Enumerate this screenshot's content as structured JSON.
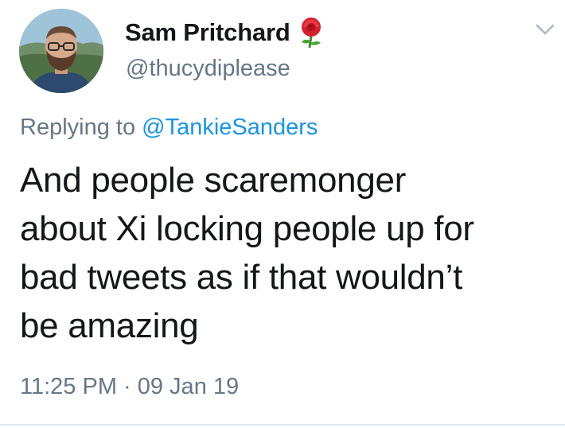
{
  "author": {
    "display_name": "Sam Pritchard",
    "name_emoji": "rose-icon",
    "handle": "@thucydiplease",
    "avatar": "avatar-photo"
  },
  "reply": {
    "prefix": "Replying to ",
    "mention": "@TankieSanders"
  },
  "tweet": {
    "text": "And people scaremonger\nabout Xi locking people up for\nbad tweets as if that wouldn’t\nbe amazing",
    "timestamp": "11:25 PM · 09 Jan 19"
  },
  "menu": {
    "icon": "chevron-down-icon"
  },
  "colors": {
    "text_primary": "#14171a",
    "text_secondary": "#657786",
    "link": "#1b95e0",
    "divider": "#e1e8ed"
  }
}
